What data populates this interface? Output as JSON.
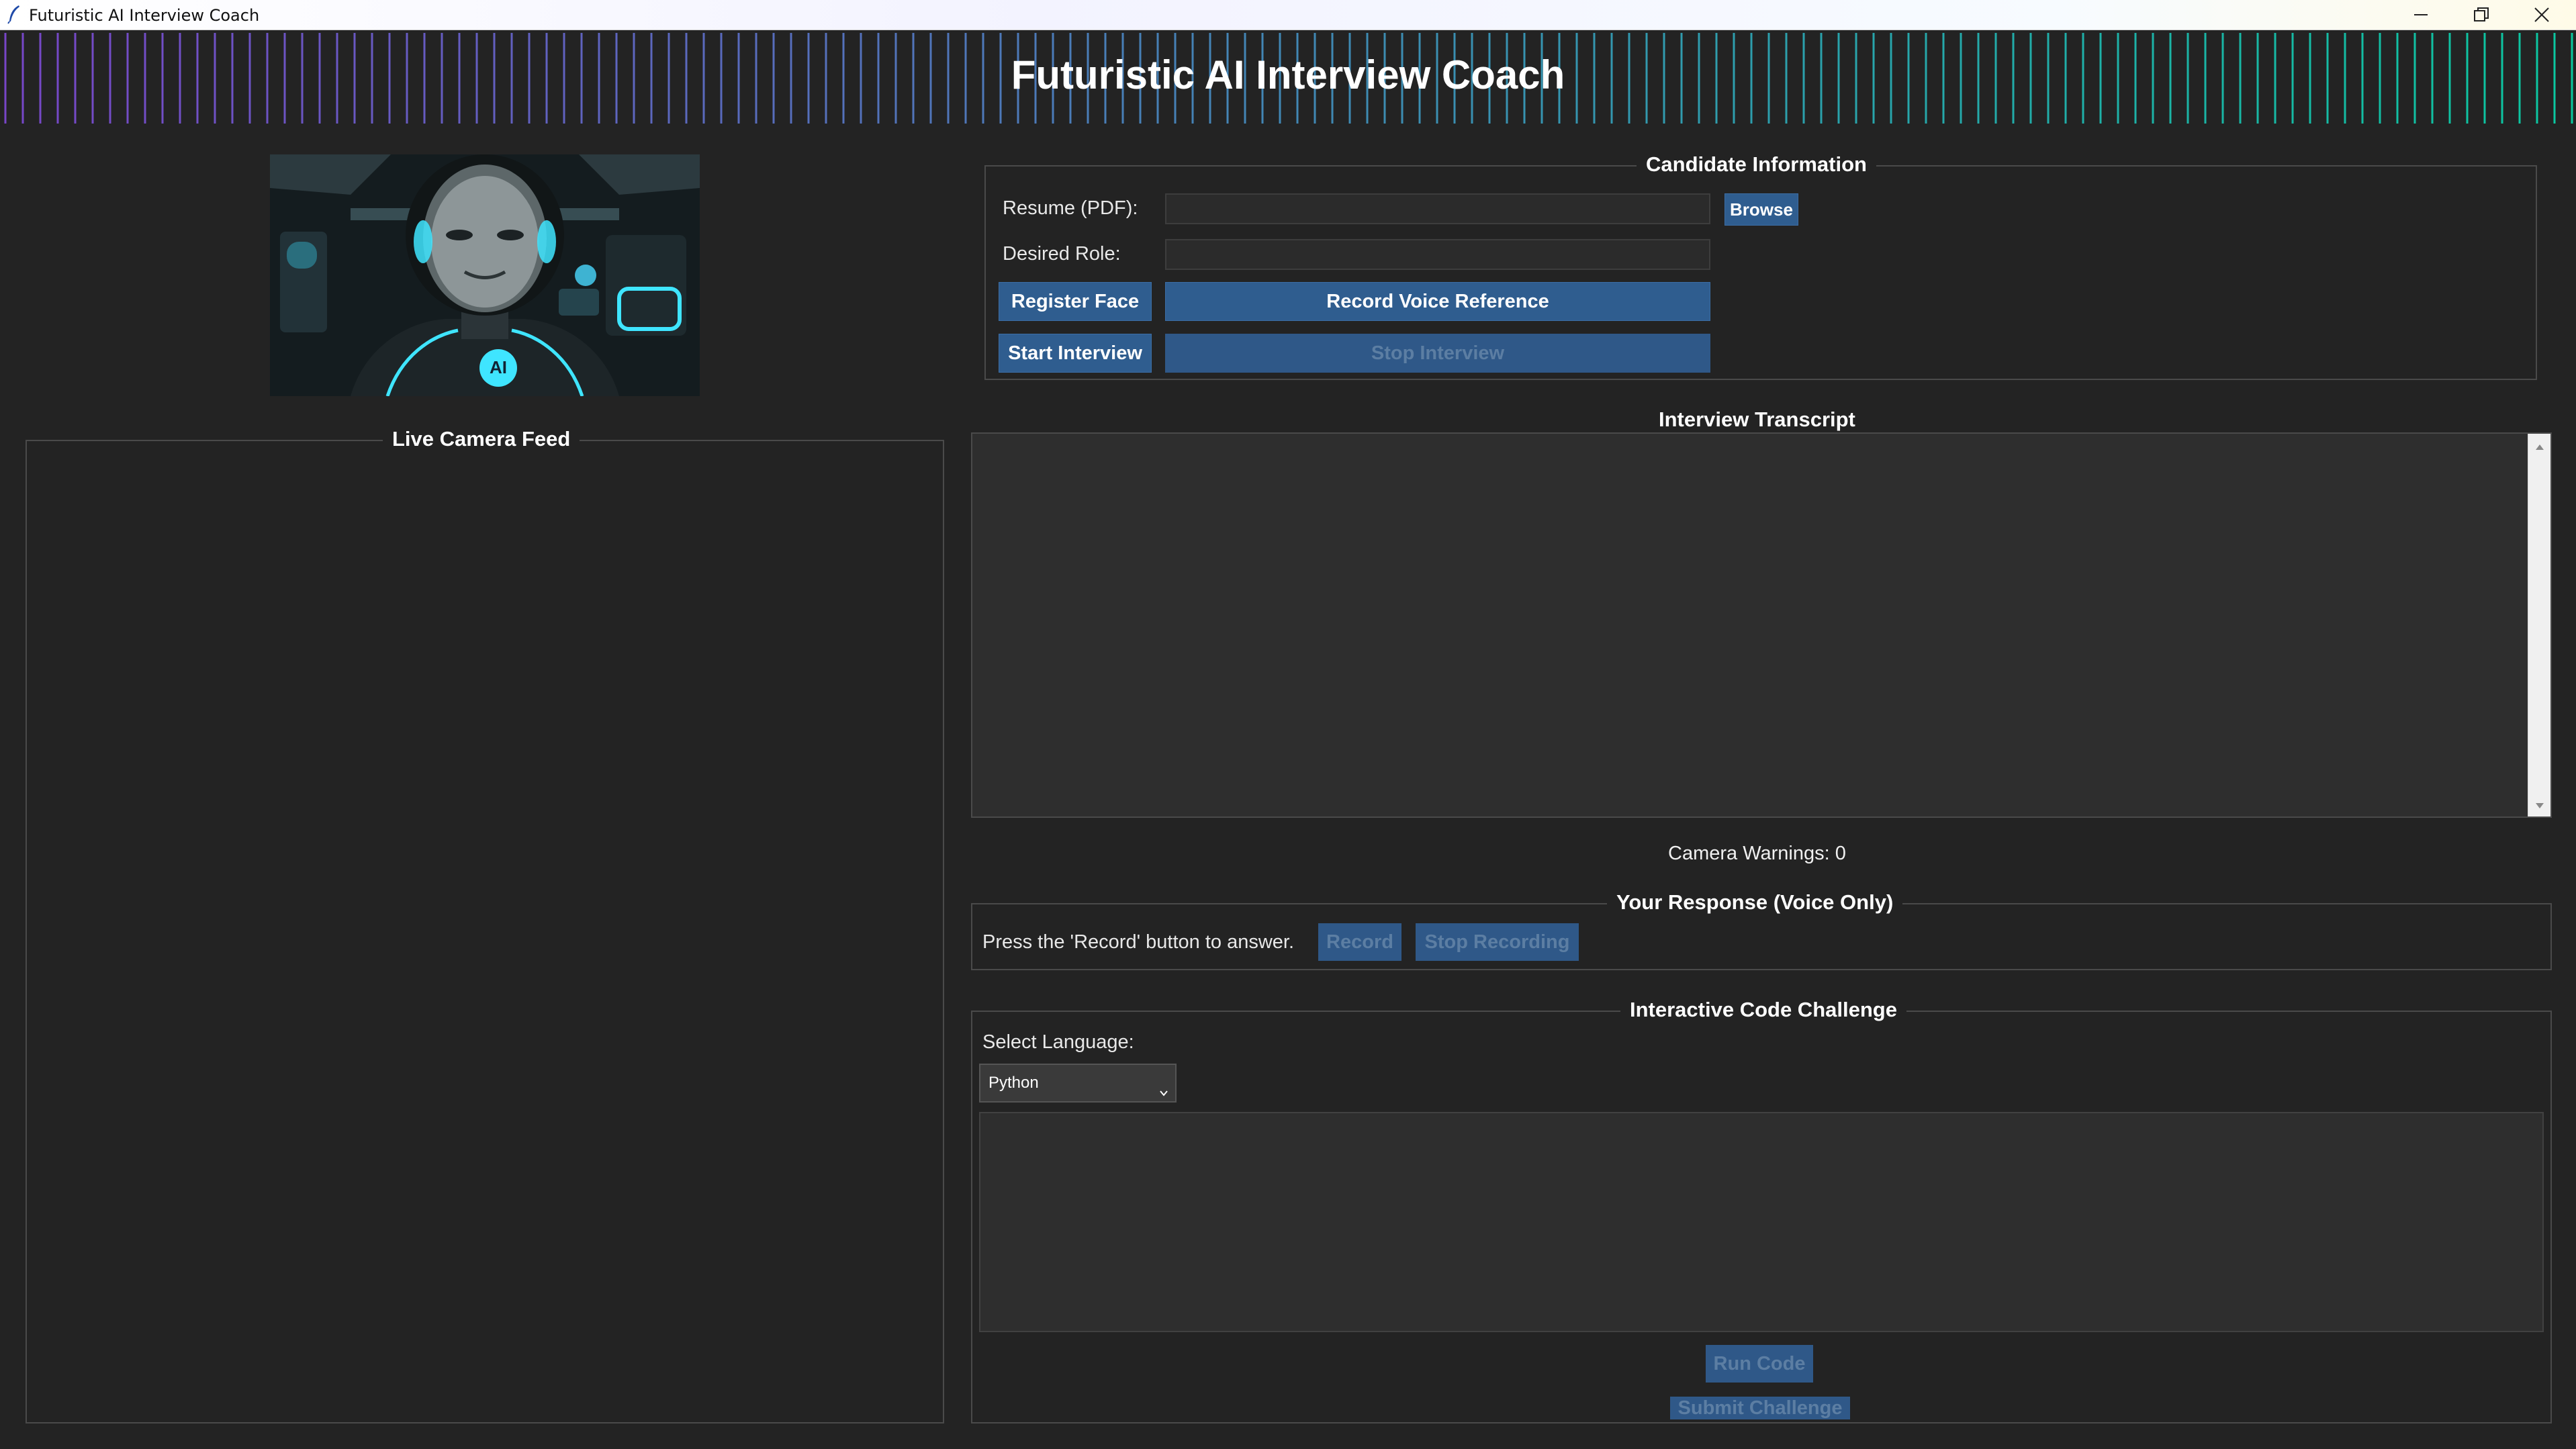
{
  "window": {
    "title": "Futuristic AI Interview Coach"
  },
  "header": {
    "title": "Futuristic AI Interview Coach"
  },
  "avatar": {
    "badge": "AI"
  },
  "camera": {
    "title": "Live Camera Feed"
  },
  "candidate": {
    "title": "Candidate Information",
    "resume_label": "Resume (PDF):",
    "resume_value": "",
    "role_label": "Desired Role:",
    "role_value": "",
    "browse_label": "Browse",
    "register_face_label": "Register Face",
    "record_voice_label": "Record Voice Reference",
    "start_interview_label": "Start Interview",
    "stop_interview_label": "Stop Interview"
  },
  "transcript": {
    "title": "Interview Transcript",
    "text": ""
  },
  "warnings": {
    "text": "Camera Warnings: 0"
  },
  "response": {
    "title": "Your Response (Voice Only)",
    "instruction": "Press the 'Record' button to answer.",
    "record_label": "Record",
    "stop_recording_label": "Stop Recording"
  },
  "code": {
    "title": "Interactive Code Challenge",
    "language_label": "Select Language:",
    "language_value": "Python",
    "editor_text": "",
    "run_label": "Run Code",
    "submit_label": "Submit Challenge"
  },
  "colors": {
    "background": "#232323",
    "button": "#2f5d8f",
    "button_disabled_text": "#5c7ea3",
    "accent_cyan": "#2fe0ff"
  }
}
